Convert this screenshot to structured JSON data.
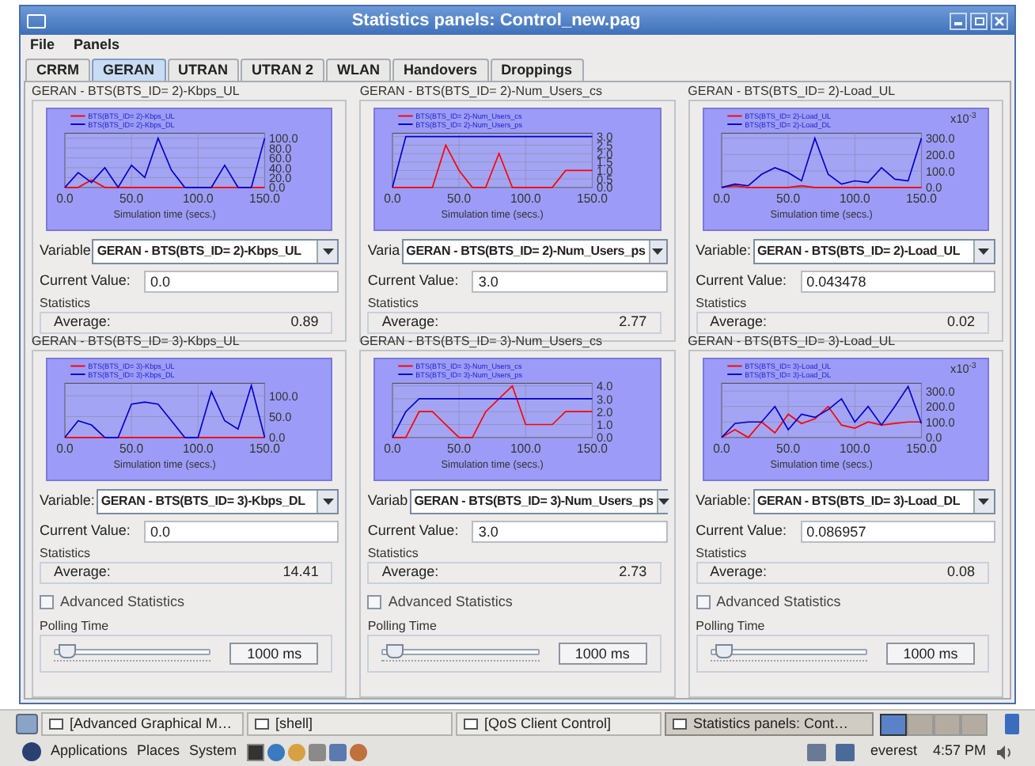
{
  "window": {
    "title": "Statistics panels:  Control_new.pag"
  },
  "menu": [
    "File",
    "Panels"
  ],
  "tabs": [
    {
      "label": "CRRM",
      "selected": false
    },
    {
      "label": "GERAN",
      "selected": true
    },
    {
      "label": "UTRAN",
      "selected": false
    },
    {
      "label": "UTRAN 2",
      "selected": false
    },
    {
      "label": "WLAN",
      "selected": false
    },
    {
      "label": "Handovers",
      "selected": false
    },
    {
      "label": "Droppings",
      "selected": false
    }
  ],
  "panels": [
    {
      "title": "GERAN - BTS(BTS_ID= 2)-Kbps_UL",
      "chart_data": {
        "type": "line",
        "grid": true,
        "legend": true,
        "xlabel": "Simulation time (secs.)",
        "x": [
          0,
          10,
          20,
          30,
          40,
          50,
          60,
          70,
          80,
          90,
          100,
          110,
          120,
          130,
          140,
          150
        ],
        "xlim": [
          0,
          150
        ],
        "ylim": [
          0,
          110
        ],
        "xticks": [
          {
            "value": 0,
            "label": "0.0"
          },
          {
            "value": 50,
            "label": "50.0"
          },
          {
            "value": 100,
            "label": "100.0"
          },
          {
            "value": 150,
            "label": "150.0"
          }
        ],
        "yticks": [
          {
            "value": 0,
            "label": "0.0"
          },
          {
            "value": 20,
            "label": "20.0"
          },
          {
            "value": 40,
            "label": "40.0"
          },
          {
            "value": 60,
            "label": "60.0"
          },
          {
            "value": 80,
            "label": "80.0"
          },
          {
            "value": 100,
            "label": "100.0"
          }
        ],
        "series": [
          {
            "name": "BTS(BTS_ID= 2)-Kbps_UL",
            "color": "#ff0000",
            "values": [
              0,
              0,
              15,
              0,
              0,
              0,
              0,
              0,
              0,
              0,
              0,
              0,
              0,
              0,
              0,
              0
            ]
          },
          {
            "name": "BTS(BTS_ID= 2)-Kbps_DL",
            "color": "#0000cc",
            "values": [
              0,
              30,
              10,
              40,
              0,
              45,
              20,
              100,
              35,
              0,
              0,
              0,
              45,
              0,
              0,
              100
            ]
          }
        ]
      },
      "variable_label": "Variable",
      "variable": "GERAN - BTS(BTS_ID= 2)-Kbps_UL",
      "current_label": "Current Value:",
      "current": "0.0",
      "statistics_label": "Statistics",
      "average_label": "Average:",
      "average": "0.89"
    },
    {
      "title": "GERAN - BTS(BTS_ID= 2)-Num_Users_cs",
      "chart_data": {
        "type": "line",
        "grid": true,
        "legend": true,
        "xlabel": "Simulation time (secs.)",
        "x": [
          0,
          10,
          20,
          30,
          40,
          50,
          60,
          70,
          80,
          90,
          100,
          110,
          120,
          130,
          140,
          150
        ],
        "xlim": [
          0,
          150
        ],
        "ylim": [
          0,
          3.2
        ],
        "xticks": [
          {
            "value": 0,
            "label": "0.0"
          },
          {
            "value": 50,
            "label": "50.0"
          },
          {
            "value": 100,
            "label": "100.0"
          },
          {
            "value": 150,
            "label": "150.0"
          }
        ],
        "yticks": [
          {
            "value": 0,
            "label": "0.0"
          },
          {
            "value": 0.5,
            "label": "0.5"
          },
          {
            "value": 1,
            "label": "1.0"
          },
          {
            "value": 1.5,
            "label": "1.5"
          },
          {
            "value": 2,
            "label": "2.0"
          },
          {
            "value": 2.5,
            "label": "2.5"
          },
          {
            "value": 3,
            "label": "3.0"
          }
        ],
        "series": [
          {
            "name": "BTS(BTS_ID= 2)-Num_Users_cs",
            "color": "#ff0000",
            "values": [
              0,
              0,
              0,
              0,
              2.5,
              1,
              0,
              0,
              2,
              0,
              0,
              0,
              0,
              1,
              1,
              1
            ]
          },
          {
            "name": "BTS(BTS_ID= 2)-Num_Users_ps",
            "color": "#0000cc",
            "values": [
              0,
              3,
              3,
              3,
              3,
              3,
              3,
              3,
              3,
              3,
              3,
              3,
              3,
              3,
              3,
              3
            ]
          }
        ]
      },
      "variable_label": "Varia",
      "variable": "GERAN - BTS(BTS_ID= 2)-Num_Users_ps",
      "current_label": "Current Value:",
      "current": "3.0",
      "statistics_label": "Statistics",
      "average_label": "Average:",
      "average": "2.77"
    },
    {
      "title": "GERAN - BTS(BTS_ID= 2)-Load_UL",
      "scale": "x10",
      "scale_exponent": "-3",
      "chart_data": {
        "type": "line",
        "grid": true,
        "legend": true,
        "xlabel": "Simulation time (secs.)",
        "x": [
          0,
          10,
          20,
          30,
          40,
          50,
          60,
          70,
          80,
          90,
          100,
          110,
          120,
          130,
          140,
          150
        ],
        "xlim": [
          0,
          150
        ],
        "ylim": [
          0,
          330
        ],
        "xticks": [
          {
            "value": 0,
            "label": "0.0"
          },
          {
            "value": 50,
            "label": "50.0"
          },
          {
            "value": 100,
            "label": "100.0"
          },
          {
            "value": 150,
            "label": "150.0"
          }
        ],
        "yticks": [
          {
            "value": 0,
            "label": "0.0"
          },
          {
            "value": 100,
            "label": "100.0"
          },
          {
            "value": 200,
            "label": "200.0"
          },
          {
            "value": 300,
            "label": "300.0"
          }
        ],
        "series": [
          {
            "name": "BTS(BTS_ID= 2)-Load_UL",
            "color": "#ff0000",
            "values": [
              0,
              10,
              0,
              0,
              0,
              0,
              10,
              0,
              0,
              0,
              0,
              0,
              0,
              0,
              0,
              0
            ]
          },
          {
            "name": "BTS(BTS_ID= 2)-Load_DL",
            "color": "#0000cc",
            "values": [
              0,
              20,
              10,
              80,
              120,
              90,
              40,
              300,
              80,
              20,
              40,
              30,
              120,
              50,
              40,
              300
            ]
          }
        ]
      },
      "variable_label": "Variable:",
      "variable": "GERAN - BTS(BTS_ID= 2)-Load_UL",
      "current_label": "Current Value:",
      "current": "0.043478",
      "statistics_label": "Statistics",
      "average_label": "Average:",
      "average": "0.02"
    },
    {
      "title": "GERAN - BTS(BTS_ID= 3)-Kbps_UL",
      "chart_data": {
        "type": "line",
        "grid": true,
        "legend": true,
        "xlabel": "Simulation time (secs.)",
        "x": [
          0,
          10,
          20,
          30,
          40,
          50,
          60,
          70,
          80,
          90,
          100,
          110,
          120,
          130,
          140,
          150
        ],
        "xlim": [
          0,
          150
        ],
        "ylim": [
          0,
          130
        ],
        "xticks": [
          {
            "value": 0,
            "label": "0.0"
          },
          {
            "value": 50,
            "label": "50.0"
          },
          {
            "value": 100,
            "label": "100.0"
          },
          {
            "value": 150,
            "label": "150.0"
          }
        ],
        "yticks": [
          {
            "value": 0,
            "label": "0.0"
          },
          {
            "value": 50,
            "label": "50.0"
          },
          {
            "value": 100,
            "label": "100.0"
          }
        ],
        "series": [
          {
            "name": "BTS(BTS_ID= 3)-Kbps_UL",
            "color": "#ff0000",
            "values": [
              0,
              0,
              0,
              0,
              0,
              0,
              0,
              0,
              0,
              0,
              0,
              0,
              0,
              0,
              0,
              0
            ]
          },
          {
            "name": "BTS(BTS_ID= 3)-Kbps_DL",
            "color": "#0000cc",
            "values": [
              0,
              40,
              30,
              0,
              0,
              80,
              85,
              80,
              40,
              0,
              0,
              110,
              40,
              20,
              125,
              0
            ]
          }
        ]
      },
      "variable_label": "Variable:",
      "variable": "GERAN - BTS(BTS_ID= 3)-Kbps_DL",
      "current_label": "Current Value:",
      "current": "0.0",
      "statistics_label": "Statistics",
      "average_label": "Average:",
      "average": "14.41",
      "advanced": {
        "label": "Advanced Statistics",
        "checked": false
      },
      "polling": {
        "label": "Polling Time",
        "level": 0.08,
        "value": "1000 ms"
      }
    },
    {
      "title": "GERAN - BTS(BTS_ID= 3)-Num_Users_cs",
      "chart_data": {
        "type": "line",
        "grid": true,
        "legend": true,
        "xlabel": "Simulation time (secs.)",
        "x": [
          0,
          10,
          20,
          30,
          40,
          50,
          60,
          70,
          80,
          90,
          100,
          110,
          120,
          130,
          140,
          150
        ],
        "xlim": [
          0,
          150
        ],
        "ylim": [
          0,
          4.2
        ],
        "xticks": [
          {
            "value": 0,
            "label": "0.0"
          },
          {
            "value": 50,
            "label": "50.0"
          },
          {
            "value": 100,
            "label": "100.0"
          },
          {
            "value": 150,
            "label": "150.0"
          }
        ],
        "yticks": [
          {
            "value": 0,
            "label": "0.0"
          },
          {
            "value": 1,
            "label": "1.0"
          },
          {
            "value": 2,
            "label": "2.0"
          },
          {
            "value": 3,
            "label": "3.0"
          },
          {
            "value": 4,
            "label": "4.0"
          }
        ],
        "series": [
          {
            "name": "BTS(BTS_ID= 3)-Num_Users_cs",
            "color": "#ff0000",
            "values": [
              0,
              0,
              2,
              2,
              1,
              0,
              0,
              2,
              3,
              4,
              1,
              1,
              1,
              2,
              2,
              2
            ]
          },
          {
            "name": "BTS(BTS_ID= 3)-Num_Users_ps",
            "color": "#0000cc",
            "values": [
              0,
              2,
              3,
              3,
              3,
              3,
              3,
              3,
              3,
              3,
              3,
              3,
              3,
              3,
              3,
              3
            ]
          }
        ]
      },
      "variable_label": "Variab",
      "variable": "GERAN - BTS(BTS_ID= 3)-Num_Users_ps",
      "current_label": "Current Value:",
      "current": "3.0",
      "statistics_label": "Statistics",
      "average_label": "Average:",
      "average": "2.73",
      "advanced": {
        "label": "Advanced Statistics",
        "checked": false
      },
      "polling": {
        "label": "Polling Time",
        "level": 0.08,
        "value": "1000 ms"
      }
    },
    {
      "title": "GERAN - BTS(BTS_ID= 3)-Load_UL",
      "scale": "x10",
      "scale_exponent": "-3",
      "chart_data": {
        "type": "line",
        "grid": true,
        "legend": true,
        "xlabel": "Simulation time (secs.)",
        "x": [
          0,
          10,
          20,
          30,
          40,
          50,
          60,
          70,
          80,
          90,
          100,
          110,
          120,
          130,
          140,
          150
        ],
        "xlim": [
          0,
          150
        ],
        "ylim": [
          0,
          350
        ],
        "xticks": [
          {
            "value": 0,
            "label": "0.0"
          },
          {
            "value": 50,
            "label": "50.0"
          },
          {
            "value": 100,
            "label": "100.0"
          },
          {
            "value": 150,
            "label": "150.0"
          }
        ],
        "yticks": [
          {
            "value": 0,
            "label": "0.0"
          },
          {
            "value": 100,
            "label": "100.0"
          },
          {
            "value": 200,
            "label": "200.0"
          },
          {
            "value": 300,
            "label": "300.0"
          }
        ],
        "series": [
          {
            "name": "BTS(BTS_ID= 3)-Load_UL",
            "color": "#ff0000",
            "values": [
              0,
              50,
              0,
              100,
              30,
              150,
              90,
              120,
              200,
              80,
              60,
              100,
              80,
              90,
              100,
              100
            ]
          },
          {
            "name": "BTS(BTS_ID= 3)-Load_DL",
            "color": "#0000cc",
            "values": [
              0,
              90,
              100,
              100,
              200,
              50,
              150,
              130,
              180,
              250,
              100,
              200,
              80,
              200,
              330,
              90
            ]
          }
        ]
      },
      "variable_label": "Variable:",
      "variable": "GERAN - BTS(BTS_ID= 3)-Load_DL",
      "current_label": "Current Value:",
      "current": "0.086957",
      "statistics_label": "Statistics",
      "average_label": "Average:",
      "average": "0.08",
      "advanced": {
        "label": "Advanced Statistics",
        "checked": false
      },
      "polling": {
        "label": "Polling Time",
        "level": 0.08,
        "value": "1000 ms"
      }
    }
  ],
  "taskbar": [
    {
      "label": "[Advanced Graphical M…",
      "selected": false
    },
    {
      "label": "[shell]",
      "selected": false
    },
    {
      "label": "[QoS Client Control]",
      "selected": false
    },
    {
      "label": "Statistics panels:  Cont…",
      "selected": true
    }
  ],
  "panel_menu": [
    "Applications",
    "Places",
    "System"
  ],
  "user": "everest",
  "clock": "4:57 PM"
}
